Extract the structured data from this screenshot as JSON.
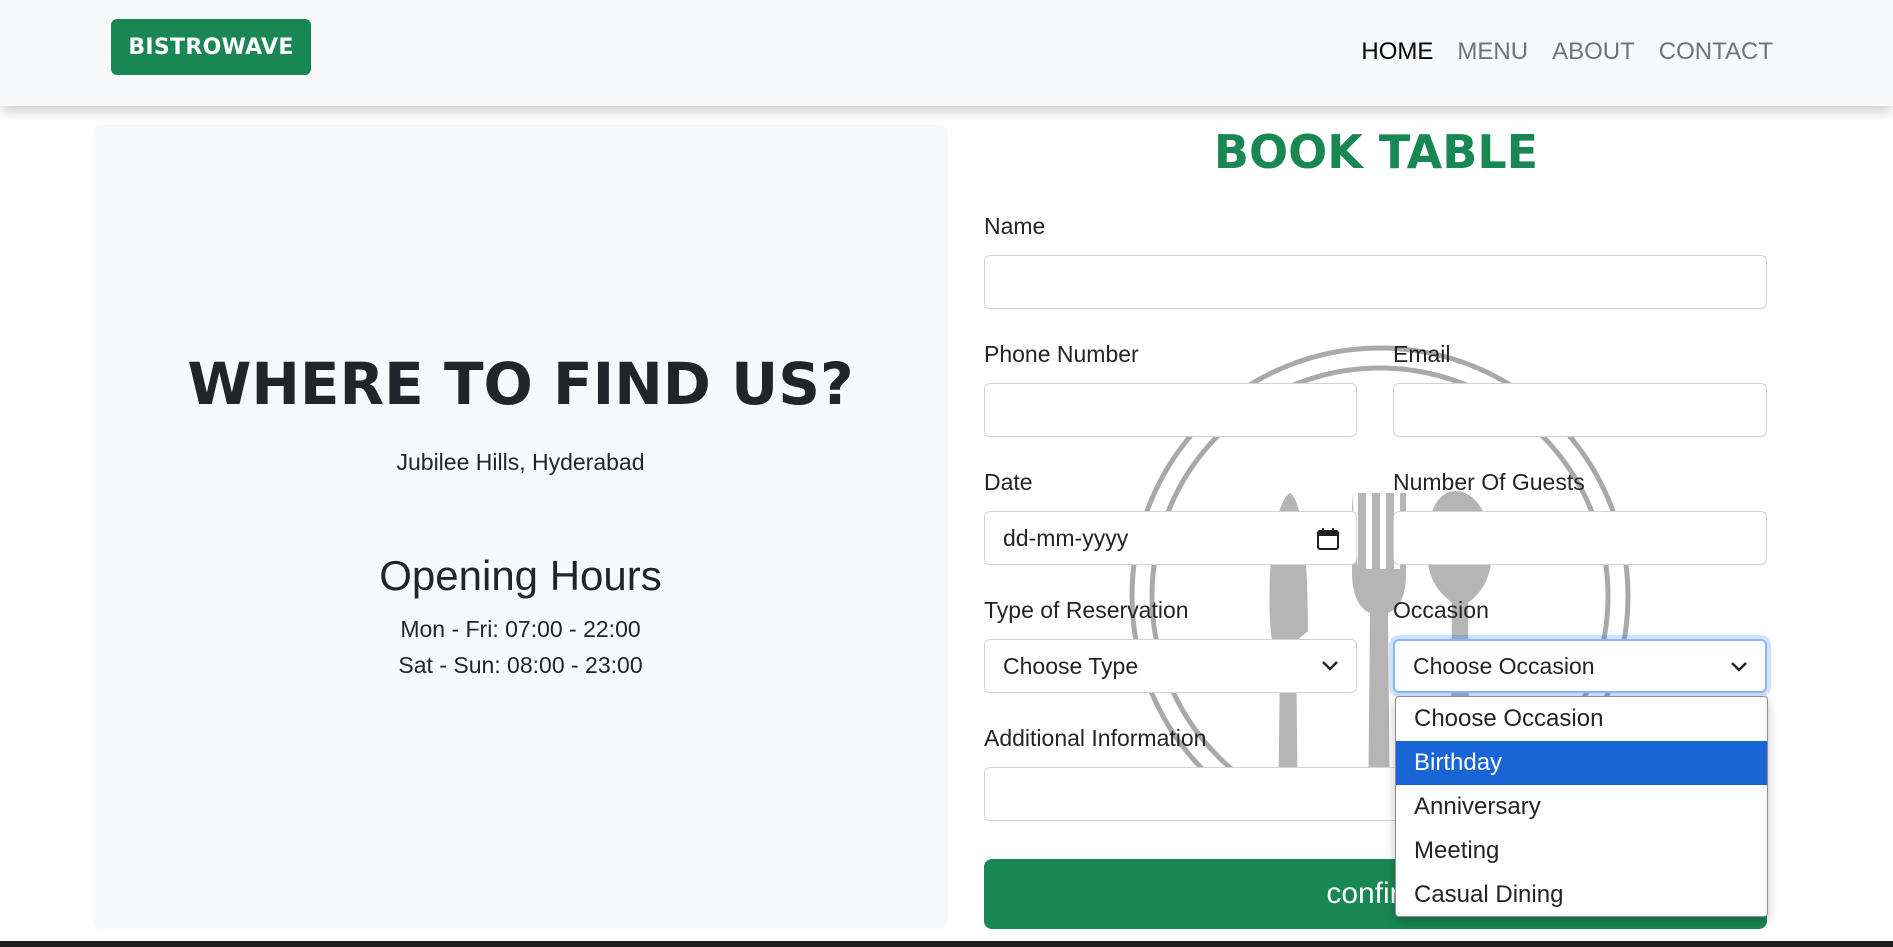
{
  "navbar": {
    "brand": "BISTROWAVE",
    "links": [
      "HOME",
      "MENU",
      "ABOUT",
      "CONTACT"
    ],
    "active": "HOME"
  },
  "location": {
    "title": "WHERE TO FIND US?",
    "address": "Jubilee Hills, Hyderabad",
    "hours_title": "Opening Hours",
    "hours": [
      "Mon - Fri: 07:00 - 22:00",
      "Sat - Sun: 08:00 - 23:00"
    ]
  },
  "form": {
    "title": "BOOK TABLE",
    "name_label": "Name",
    "name_value": "",
    "phone_label": "Phone Number",
    "phone_value": "",
    "email_label": "Email",
    "email_value": "",
    "date_label": "Date",
    "date_placeholder": "dd-mm-yyyy",
    "guests_label": "Number Of Guests",
    "guests_value": "",
    "type_label": "Type of Reservation",
    "type_selected": "Choose Type",
    "occasion_label": "Occasion",
    "occasion_selected": "Choose Occasion",
    "info_label": "Additional Information",
    "info_value": "",
    "confirm_label": "confirm"
  },
  "occasion_dropdown": {
    "options": [
      "Choose Occasion",
      "Birthday",
      "Anniversary",
      "Meeting",
      "Casual Dining"
    ],
    "highlighted": "Birthday"
  },
  "colors": {
    "brand_green": "#198754",
    "navbar_bg": "#f8f9fa",
    "option_highlight": "#1a65d6",
    "focus_ring": "#86b7fe"
  }
}
